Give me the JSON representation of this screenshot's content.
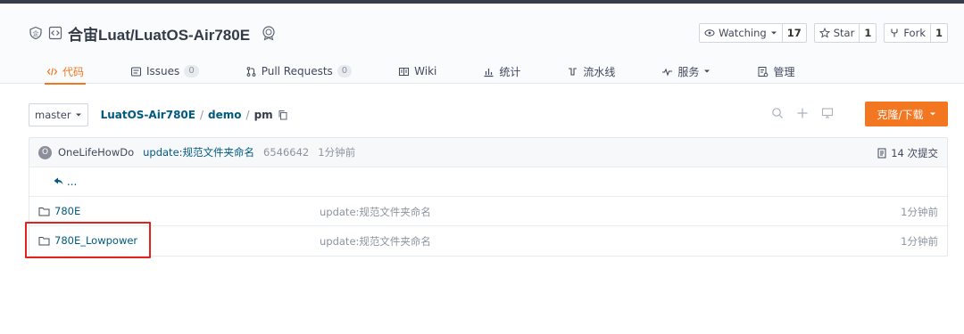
{
  "repo": {
    "title": "合宙Luat/LuatOS-Air780E"
  },
  "actions": {
    "watch_label": "Watching",
    "watch_count": "17",
    "star_label": "Star",
    "star_count": "1",
    "fork_label": "Fork",
    "fork_count": "1"
  },
  "tabs": [
    {
      "label": "代码",
      "icon": "code-icon"
    },
    {
      "label": "Issues",
      "badge": "0",
      "icon": "issues-icon"
    },
    {
      "label": "Pull Requests",
      "badge": "0",
      "icon": "pull-request-icon"
    },
    {
      "label": "Wiki",
      "icon": "wiki-icon"
    },
    {
      "label": "统计",
      "icon": "chart-icon"
    },
    {
      "label": "流水线",
      "icon": "pipeline-icon"
    },
    {
      "label": "服务",
      "icon": "pulse-icon"
    },
    {
      "label": "管理",
      "icon": "settings-doc-icon"
    }
  ],
  "branch": "master",
  "breadcrumb": {
    "repo": "LuatOS-Air780E",
    "dir1": "demo",
    "dir2": "pm",
    "sep": "/"
  },
  "clone_label": "克隆/下载",
  "commit": {
    "avatar_letter": "O",
    "author": "OneLifeHowDo",
    "message": "update:规范文件夹命名",
    "sha": "6546642",
    "time": "1分钟前",
    "count": "14 次提交"
  },
  "back_label": "...",
  "files": [
    {
      "name": "780E",
      "message": "update:规范文件夹命名",
      "time": "1分钟前"
    },
    {
      "name": "780E_Lowpower",
      "message": "update:规范文件夹命名",
      "time": "1分钟前"
    }
  ],
  "colors": {
    "accent": "#f37621",
    "link": "#005980",
    "highlight": "#e0231f"
  }
}
